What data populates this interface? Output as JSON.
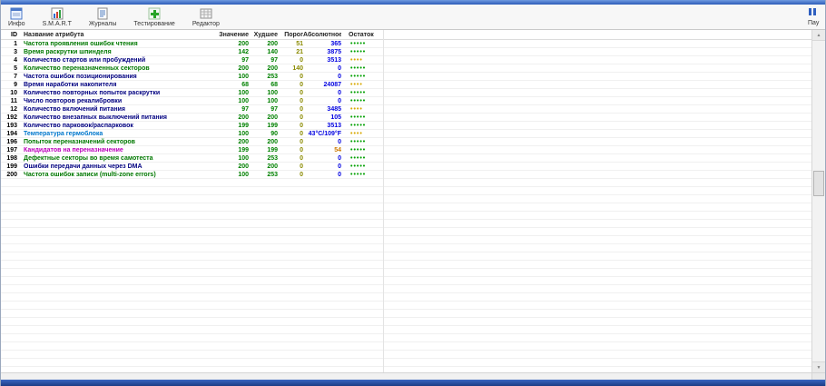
{
  "toolbar": {
    "buttons": [
      {
        "label": "Инфо"
      },
      {
        "label": "S.M.A.R.T"
      },
      {
        "label": "Журналы"
      },
      {
        "label": "Тестирование"
      },
      {
        "label": "Редактор"
      }
    ],
    "pause_label": "Пау"
  },
  "table": {
    "headers": [
      "ID",
      "Название атрибута",
      "Значение",
      "Худшее",
      "Порог",
      "Абсолютное",
      "Остаток"
    ],
    "rows": [
      {
        "id": "1",
        "name": "Частота проявления ошибок чтения",
        "value": "200",
        "worst": "200",
        "threshold": "51",
        "absolute": "365",
        "dots": 5,
        "dot_color": "green",
        "name_color": "green"
      },
      {
        "id": "3",
        "name": "Время раскрутки шпинделя",
        "value": "142",
        "worst": "140",
        "threshold": "21",
        "absolute": "3875",
        "dots": 5,
        "dot_color": "green",
        "name_color": "green"
      },
      {
        "id": "4",
        "name": "Количество стартов или пробуждений",
        "value": "97",
        "worst": "97",
        "threshold": "0",
        "absolute": "3513",
        "dots": 4,
        "dot_color": "yellow",
        "name_color": "navy"
      },
      {
        "id": "5",
        "name": "Количество переназначенных секторов",
        "value": "200",
        "worst": "200",
        "threshold": "140",
        "absolute": "0",
        "dots": 5,
        "dot_color": "green",
        "name_color": "green"
      },
      {
        "id": "7",
        "name": "Частота ошибок позиционирования",
        "value": "100",
        "worst": "253",
        "threshold": "0",
        "absolute": "0",
        "dots": 5,
        "dot_color": "green",
        "name_color": "navy"
      },
      {
        "id": "9",
        "name": "Время наработки накопителя",
        "value": "68",
        "worst": "68",
        "threshold": "0",
        "absolute": "24087",
        "dots": 4,
        "dot_color": "yellow",
        "name_color": "navy"
      },
      {
        "id": "10",
        "name": "Количество повторных попыток раскрутки",
        "value": "100",
        "worst": "100",
        "threshold": "0",
        "absolute": "0",
        "dots": 5,
        "dot_color": "green",
        "name_color": "navy"
      },
      {
        "id": "11",
        "name": "Число повторов рекалибровки",
        "value": "100",
        "worst": "100",
        "threshold": "0",
        "absolute": "0",
        "dots": 5,
        "dot_color": "green",
        "name_color": "navy"
      },
      {
        "id": "12",
        "name": "Количество включений питания",
        "value": "97",
        "worst": "97",
        "threshold": "0",
        "absolute": "3485",
        "dots": 4,
        "dot_color": "yellow",
        "name_color": "navy"
      },
      {
        "id": "192",
        "name": "Количество внезапных выключений питания",
        "value": "200",
        "worst": "200",
        "threshold": "0",
        "absolute": "105",
        "dots": 5,
        "dot_color": "green",
        "name_color": "navy"
      },
      {
        "id": "193",
        "name": "Количество парковок/распарковок",
        "value": "199",
        "worst": "199",
        "threshold": "0",
        "absolute": "3513",
        "dots": 5,
        "dot_color": "green",
        "name_color": "navy"
      },
      {
        "id": "194",
        "name": "Температура гермоблока",
        "value": "100",
        "worst": "90",
        "threshold": "0",
        "absolute": "43°C/109°F",
        "dots": 4,
        "dot_color": "yellow",
        "name_color": "blue"
      },
      {
        "id": "196",
        "name": "Попыток переназначений секторов",
        "value": "200",
        "worst": "200",
        "threshold": "0",
        "absolute": "0",
        "dots": 5,
        "dot_color": "green",
        "name_color": "green"
      },
      {
        "id": "197",
        "name": "Кандидатов на переназначение",
        "value": "199",
        "worst": "199",
        "threshold": "0",
        "absolute": "54",
        "dots": 5,
        "dot_color": "green",
        "name_color": "magenta",
        "absolute_color": "orange"
      },
      {
        "id": "198",
        "name": "Дефектные секторы во время самотеста",
        "value": "100",
        "worst": "253",
        "threshold": "0",
        "absolute": "0",
        "dots": 5,
        "dot_color": "green",
        "name_color": "green"
      },
      {
        "id": "199",
        "name": "Ошибки передачи данных через DMA",
        "value": "200",
        "worst": "200",
        "threshold": "0",
        "absolute": "0",
        "dots": 5,
        "dot_color": "green",
        "name_color": "navy"
      },
      {
        "id": "200",
        "name": "Частота ошибок записи (multi-zone errors)",
        "value": "100",
        "worst": "253",
        "threshold": "0",
        "absolute": "0",
        "dots": 5,
        "dot_color": "green",
        "name_color": "green"
      }
    ]
  },
  "colors": {
    "attr_green": "#007800",
    "attr_navy": "#000080",
    "attr_blue": "#0077cc",
    "attr_magenta": "#bb00bb",
    "value_green": "#008000",
    "threshold_olive": "#8a8a00",
    "absolute_blue": "#0000e0",
    "dots_green": "#00a000",
    "dots_yellow": "#d8a800",
    "titlebar_blue": "#2c5cb8"
  }
}
